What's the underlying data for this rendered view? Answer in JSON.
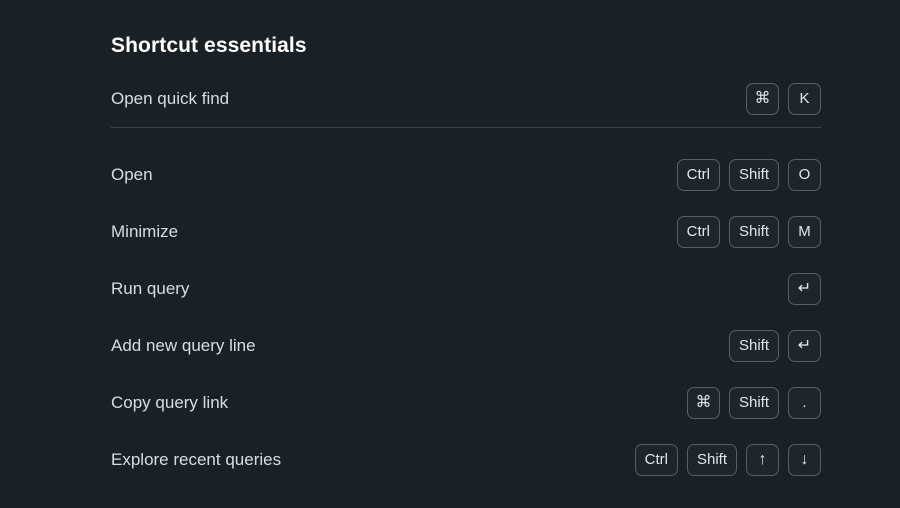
{
  "panel": {
    "title": "Shortcut essentials",
    "colors": {
      "background": "#1a2126",
      "title_text": "#ffffff",
      "label_text": "#d9dde0",
      "key_border": "#555f68",
      "key_background": "#1e262c",
      "key_text": "#e2e6e9",
      "divider": "#39444c"
    },
    "primary_shortcut": {
      "label": "Open quick find",
      "keys": [
        {
          "name": "command-key",
          "glyph": "⌘",
          "is_glyph": true
        },
        {
          "name": "letter-k-key",
          "glyph": "K",
          "is_glyph": false
        }
      ]
    },
    "shortcuts": [
      {
        "label": "Open",
        "keys": [
          {
            "name": "ctrl-key",
            "glyph": "Ctrl",
            "is_glyph": false
          },
          {
            "name": "shift-key",
            "glyph": "Shift",
            "is_glyph": false
          },
          {
            "name": "letter-o-key",
            "glyph": "O",
            "is_glyph": false
          }
        ]
      },
      {
        "label": "Minimize",
        "keys": [
          {
            "name": "ctrl-key",
            "glyph": "Ctrl",
            "is_glyph": false
          },
          {
            "name": "shift-key",
            "glyph": "Shift",
            "is_glyph": false
          },
          {
            "name": "letter-m-key",
            "glyph": "M",
            "is_glyph": false
          }
        ]
      },
      {
        "label": "Run query",
        "keys": [
          {
            "name": "enter-key",
            "glyph": "↵",
            "is_glyph": true
          }
        ]
      },
      {
        "label": "Add new query line",
        "keys": [
          {
            "name": "shift-key",
            "glyph": "Shift",
            "is_glyph": false
          },
          {
            "name": "enter-key",
            "glyph": "↵",
            "is_glyph": true
          }
        ]
      },
      {
        "label": "Copy query link",
        "keys": [
          {
            "name": "command-key",
            "glyph": "⌘",
            "is_glyph": true
          },
          {
            "name": "shift-key",
            "glyph": "Shift",
            "is_glyph": false
          },
          {
            "name": "period-key",
            "glyph": ".",
            "is_glyph": false
          }
        ]
      },
      {
        "label": "Explore recent queries",
        "keys": [
          {
            "name": "ctrl-key",
            "glyph": "Ctrl",
            "is_glyph": false
          },
          {
            "name": "shift-key",
            "glyph": "Shift",
            "is_glyph": false
          },
          {
            "name": "arrow-up-key",
            "glyph": "↑",
            "is_glyph": true
          },
          {
            "name": "arrow-down-key",
            "glyph": "↓",
            "is_glyph": true
          }
        ]
      }
    ]
  }
}
